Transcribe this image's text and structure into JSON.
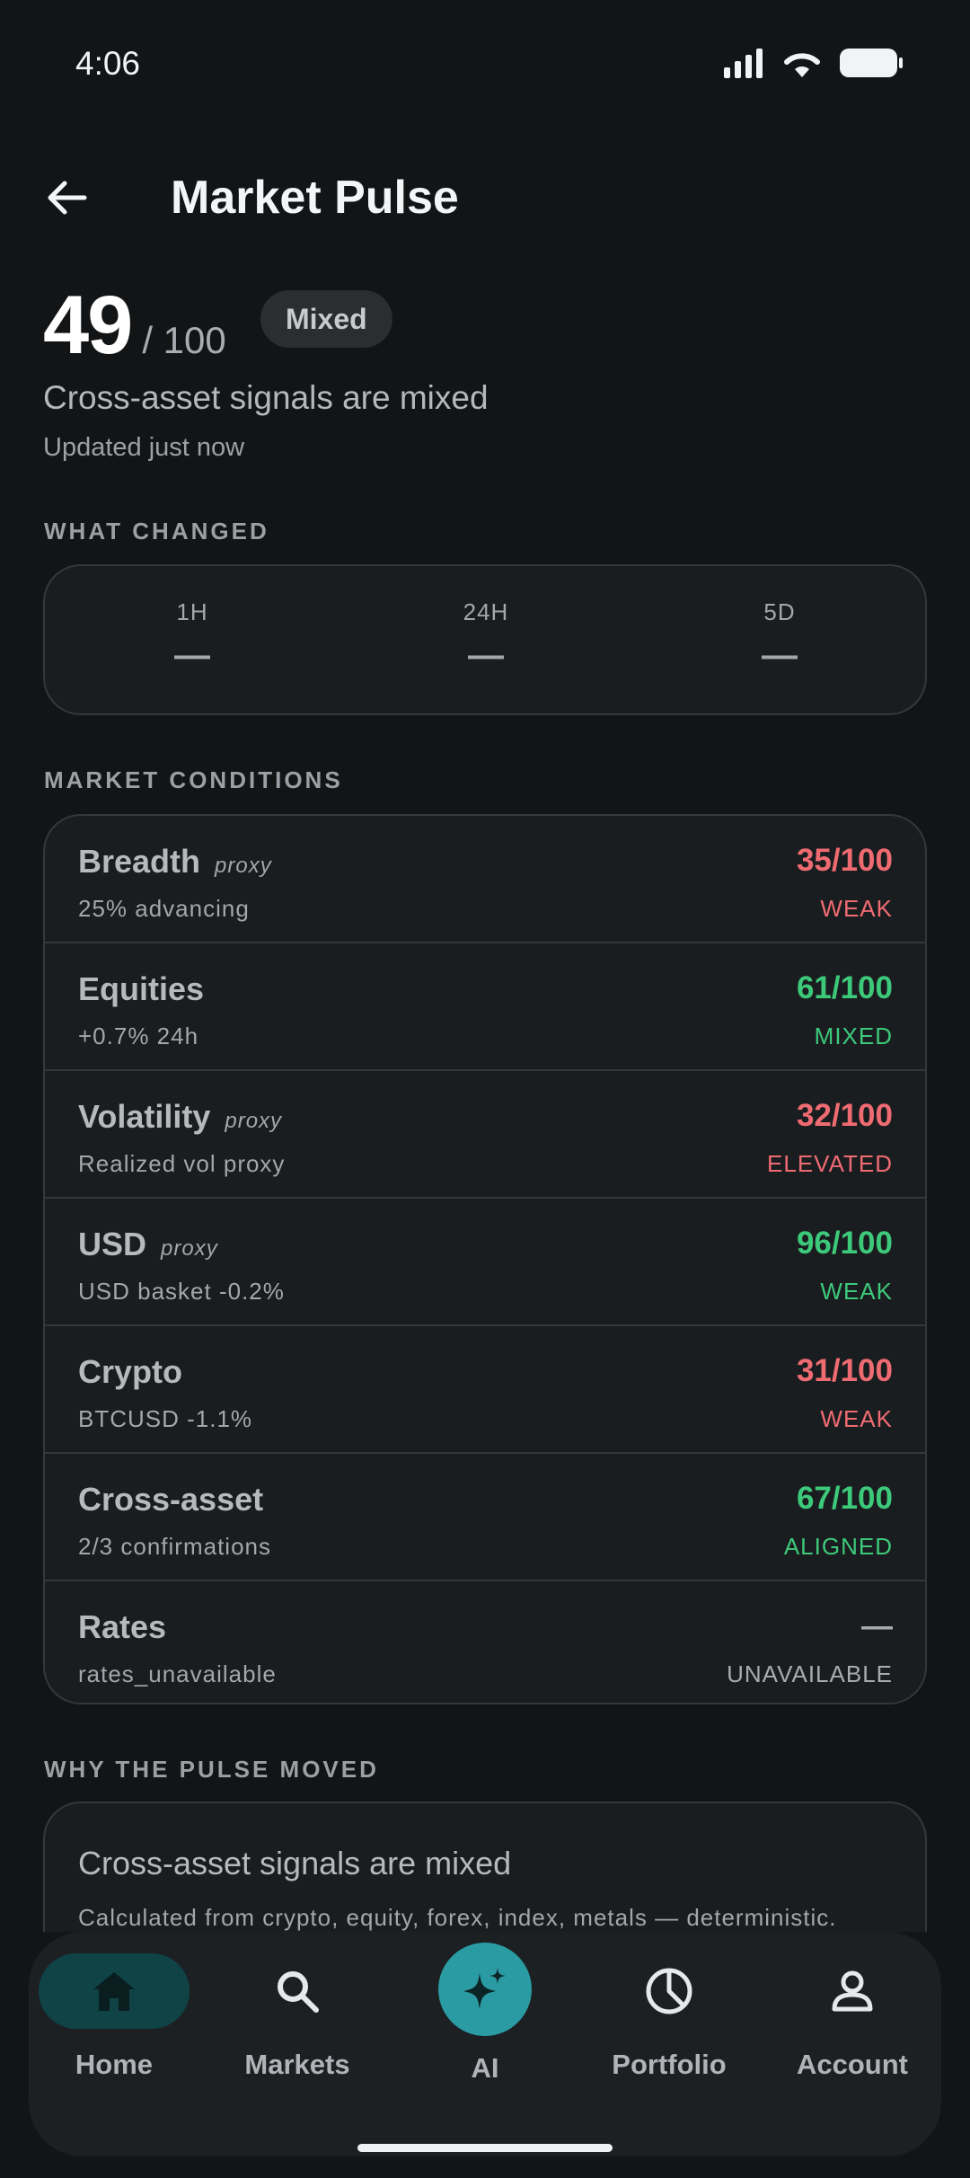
{
  "status_bar": {
    "time": "4:06"
  },
  "header": {
    "title": "Market Pulse"
  },
  "score": {
    "value": "49",
    "max": "/ 100",
    "badge": "Mixed",
    "headline": "Cross-asset signals are mixed",
    "updated": "Updated just now"
  },
  "what_changed": {
    "label": "WHAT CHANGED",
    "periods": [
      {
        "label": "1H",
        "value": "—"
      },
      {
        "label": "24H",
        "value": "—"
      },
      {
        "label": "5D",
        "value": "—"
      }
    ]
  },
  "market_conditions": {
    "label": "MARKET CONDITIONS",
    "rows": [
      {
        "name": "Breadth",
        "tag": "proxy",
        "sub": "25% advancing",
        "score": "35/100",
        "status": "WEAK",
        "tone": "red"
      },
      {
        "name": "Equities",
        "tag": "",
        "sub": "+0.7% 24h",
        "score": "61/100",
        "status": "MIXED",
        "tone": "green"
      },
      {
        "name": "Volatility",
        "tag": "proxy",
        "sub": "Realized vol proxy",
        "score": "32/100",
        "status": "ELEVATED",
        "tone": "red"
      },
      {
        "name": "USD",
        "tag": "proxy",
        "sub": "USD basket -0.2%",
        "score": "96/100",
        "status": "WEAK",
        "tone": "green"
      },
      {
        "name": "Crypto",
        "tag": "",
        "sub": "BTCUSD -1.1%",
        "score": "31/100",
        "status": "WEAK",
        "tone": "red"
      },
      {
        "name": "Cross-asset",
        "tag": "",
        "sub": "2/3 confirmations",
        "score": "67/100",
        "status": "ALIGNED",
        "tone": "green"
      },
      {
        "name": "Rates",
        "tag": "",
        "sub": "rates_unavailable",
        "score": "—",
        "status": "UNAVAILABLE",
        "tone": "grey"
      }
    ]
  },
  "why": {
    "label": "WHY THE PULSE MOVED",
    "title": "Cross-asset signals are mixed",
    "description": "Calculated from crypto, equity, forex, index, metals — deterministic."
  },
  "nav": {
    "items": [
      {
        "label": "Home",
        "icon": "home-icon"
      },
      {
        "label": "Markets",
        "icon": "search-icon"
      },
      {
        "label": "AI",
        "icon": "sparkle-icon"
      },
      {
        "label": "Portfolio",
        "icon": "pie-chart-icon"
      },
      {
        "label": "Account",
        "icon": "person-icon"
      }
    ]
  },
  "colors": {
    "red": "#ef6b72",
    "green": "#3dc97a",
    "accent": "#2a9aa3",
    "background": "#121415"
  }
}
